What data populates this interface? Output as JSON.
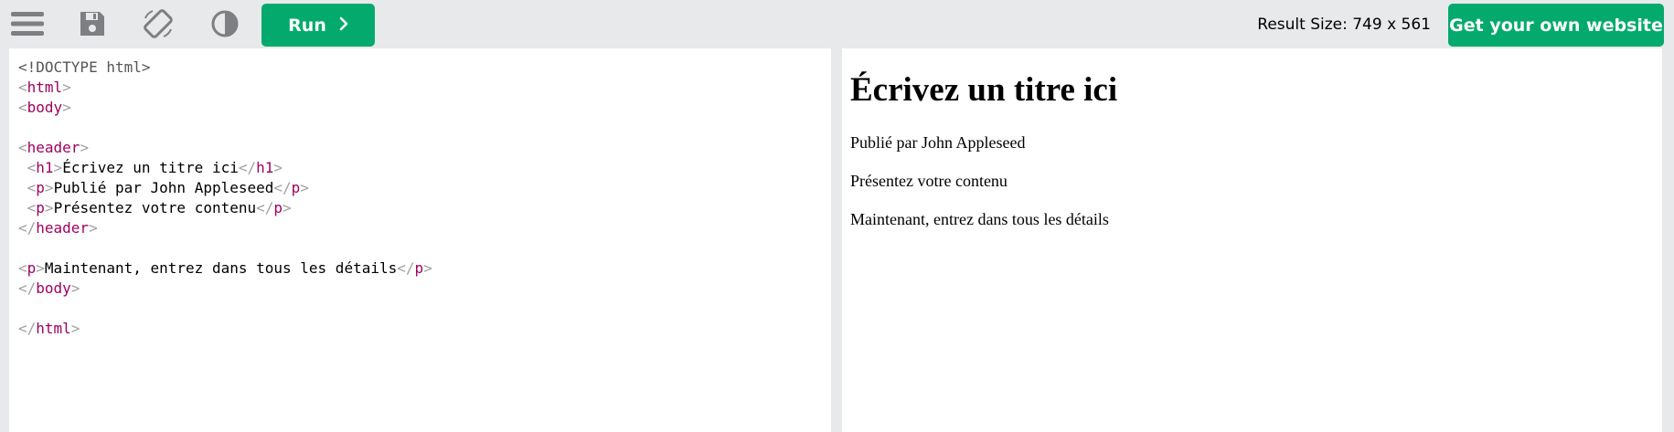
{
  "toolbar": {
    "icons": [
      "menu-icon",
      "save-icon",
      "rotate-icon",
      "contrast-icon"
    ],
    "run_label": "Run",
    "run_arrow": "›",
    "result_size": "Result Size: 749 x 561",
    "own_site_label": "Get your own website"
  },
  "code_lines": [
    [
      {
        "t": "<!DOCTYPE html>",
        "c": "doctype"
      }
    ],
    [
      {
        "t": "<",
        "c": "br"
      },
      {
        "t": "html",
        "c": "tag"
      },
      {
        "t": ">",
        "c": "br"
      }
    ],
    [
      {
        "t": "<",
        "c": "br"
      },
      {
        "t": "body",
        "c": "tag"
      },
      {
        "t": ">",
        "c": "br"
      }
    ],
    [],
    [
      {
        "t": "<",
        "c": "br"
      },
      {
        "t": "header",
        "c": "tag"
      },
      {
        "t": ">",
        "c": "br"
      }
    ],
    [
      {
        "t": " ",
        "c": "txt"
      },
      {
        "t": "<",
        "c": "br"
      },
      {
        "t": "h1",
        "c": "tag"
      },
      {
        "t": ">",
        "c": "br"
      },
      {
        "t": "Écrivez un titre ici",
        "c": "txt"
      },
      {
        "t": "</",
        "c": "br"
      },
      {
        "t": "h1",
        "c": "tag"
      },
      {
        "t": ">",
        "c": "br"
      }
    ],
    [
      {
        "t": " ",
        "c": "txt"
      },
      {
        "t": "<",
        "c": "br"
      },
      {
        "t": "p",
        "c": "tag"
      },
      {
        "t": ">",
        "c": "br"
      },
      {
        "t": "Publié par John Appleseed",
        "c": "txt"
      },
      {
        "t": "</",
        "c": "br"
      },
      {
        "t": "p",
        "c": "tag"
      },
      {
        "t": ">",
        "c": "br"
      }
    ],
    [
      {
        "t": " ",
        "c": "txt"
      },
      {
        "t": "<",
        "c": "br"
      },
      {
        "t": "p",
        "c": "tag"
      },
      {
        "t": ">",
        "c": "br"
      },
      {
        "t": "Présentez votre contenu",
        "c": "txt"
      },
      {
        "t": "</",
        "c": "br"
      },
      {
        "t": "p",
        "c": "tag"
      },
      {
        "t": ">",
        "c": "br"
      }
    ],
    [
      {
        "t": "</",
        "c": "br"
      },
      {
        "t": "header",
        "c": "tag"
      },
      {
        "t": ">",
        "c": "br"
      }
    ],
    [],
    [
      {
        "t": "<",
        "c": "br"
      },
      {
        "t": "p",
        "c": "tag"
      },
      {
        "t": ">",
        "c": "br"
      },
      {
        "t": "Maintenant, entrez dans tous les détails",
        "c": "txt"
      },
      {
        "t": "</",
        "c": "br"
      },
      {
        "t": "p",
        "c": "tag"
      },
      {
        "t": ">",
        "c": "br"
      }
    ],
    [
      {
        "t": "</",
        "c": "br"
      },
      {
        "t": "body",
        "c": "tag"
      },
      {
        "t": ">",
        "c": "br"
      }
    ],
    [],
    [
      {
        "t": "</",
        "c": "br"
      },
      {
        "t": "html",
        "c": "tag"
      },
      {
        "t": ">",
        "c": "br"
      }
    ]
  ],
  "result": {
    "heading": "Écrivez un titre ici",
    "byline": "Publié par John Appleseed",
    "intro": "Présentez votre contenu",
    "details": "Maintenant, entrez dans tous les détails"
  },
  "colors": {
    "accent": "#04aa6d",
    "toolbar_bg": "#e7e9eb",
    "tag": "#a0005f",
    "bracket": "#a0a0a0"
  }
}
